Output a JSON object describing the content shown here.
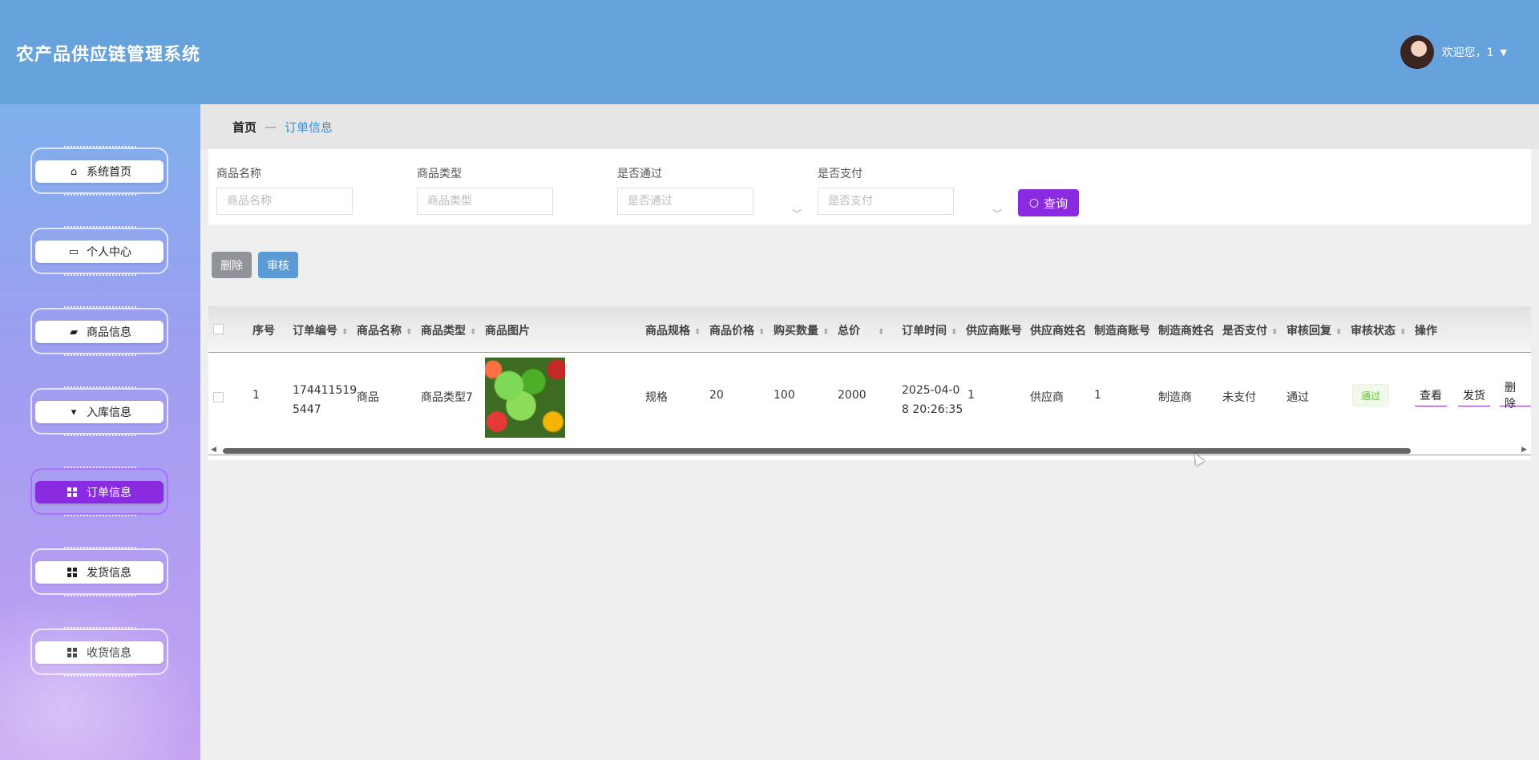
{
  "app": {
    "title": "农产品供应链管理系统"
  },
  "user": {
    "greeting": "欢迎您，1"
  },
  "sidebar": {
    "items": [
      {
        "label": "系统首页",
        "icon": "home-icon",
        "active": false
      },
      {
        "label": "个人中心",
        "icon": "card-icon",
        "active": false
      },
      {
        "label": "商品信息",
        "icon": "message-icon",
        "active": false
      },
      {
        "label": "入库信息",
        "icon": "note-icon",
        "active": false
      },
      {
        "label": "订单信息",
        "icon": "grid-icon",
        "active": true
      },
      {
        "label": "发货信息",
        "icon": "grid-icon",
        "active": false
      },
      {
        "label": "收货信息",
        "icon": "grid-icon",
        "active": false
      }
    ]
  },
  "breadcrumb": {
    "home": "首页",
    "separator": "—",
    "current": "订单信息"
  },
  "filters": {
    "fields": [
      {
        "label": "商品名称",
        "placeholder": "商品名称"
      },
      {
        "label": "商品类型",
        "placeholder": "商品类型"
      },
      {
        "label": "是否通过",
        "placeholder": "是否通过"
      },
      {
        "label": "是否支付",
        "placeholder": "是否支付"
      }
    ],
    "query_label": "查询"
  },
  "actions": {
    "delete_label": "删除",
    "review_label": "审核"
  },
  "table": {
    "columns": [
      "序号",
      "订单编号",
      "商品名称",
      "商品类型",
      "商品图片",
      "商品规格",
      "商品价格",
      "购买数量",
      "总价",
      "订单时间",
      "供应商账号",
      "供应商姓名",
      "制造商账号",
      "制造商姓名",
      "是否支付",
      "审核回复",
      "审核状态",
      "操作"
    ],
    "row": {
      "index": "1",
      "order_no_1": "174411519",
      "order_no_2": "5447",
      "product_name": "商品",
      "product_type": "商品类型7",
      "spec": "规格",
      "price": "20",
      "quantity": "100",
      "total": "2000",
      "time_1": "2025-04-0",
      "time_2": "8 20:26:35",
      "supplier_account": "1",
      "supplier_name": "供应商",
      "maker_account": "1",
      "maker_name": "制造商",
      "paid": "未支付",
      "review_reply": "通过",
      "review_status": "通过",
      "ops": [
        "查看",
        "发货",
        "删除"
      ]
    }
  },
  "colors": {
    "header": "#66a2dc",
    "accent": "#8a2be2",
    "review_button": "#5b9bd5",
    "delete_button": "#909399"
  }
}
